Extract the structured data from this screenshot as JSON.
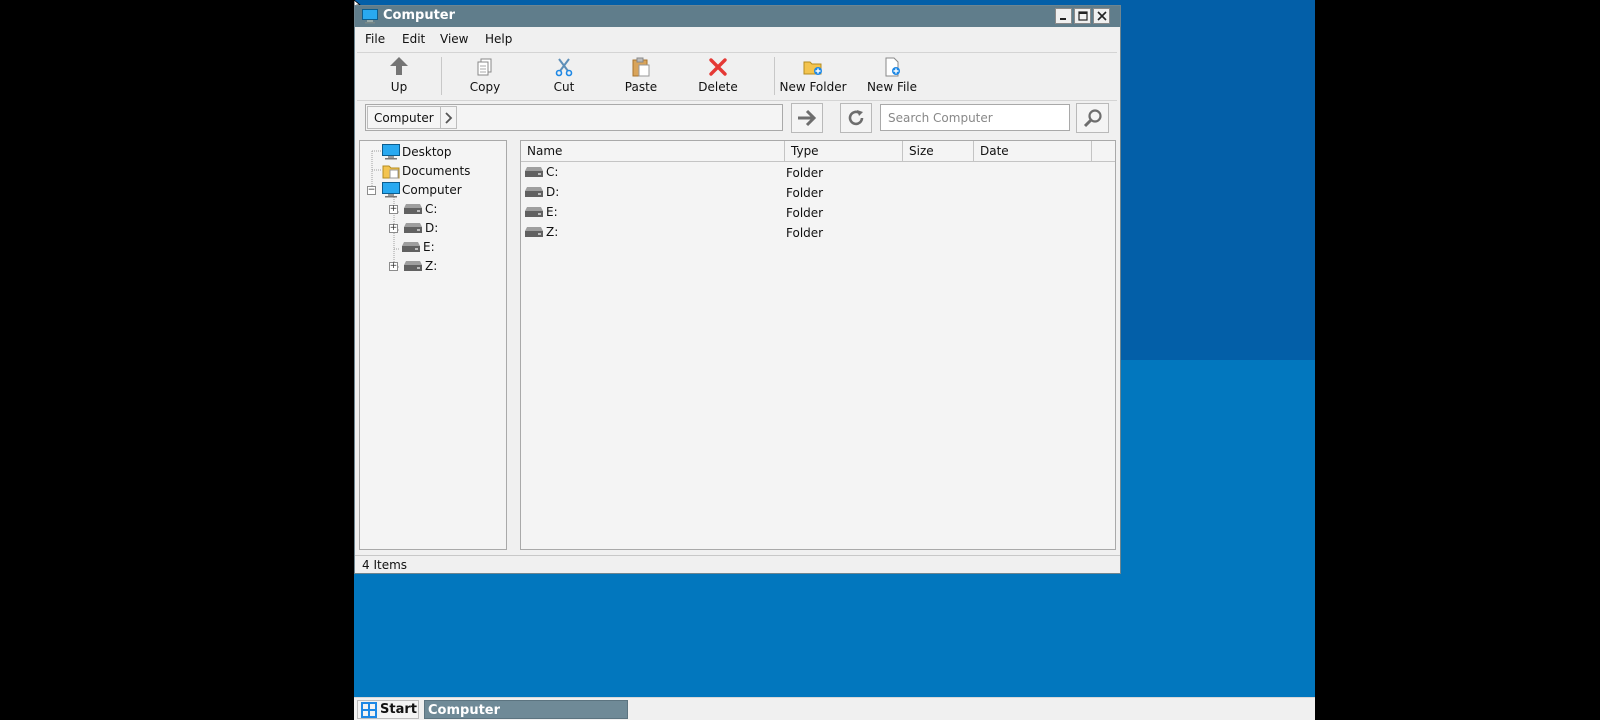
{
  "window": {
    "title": "Computer",
    "controls": [
      "minimize",
      "maximize",
      "close"
    ]
  },
  "menu": [
    "File",
    "Edit",
    "View",
    "Help"
  ],
  "toolbar": {
    "up": "Up",
    "copy": "Copy",
    "cut": "Cut",
    "paste": "Paste",
    "delete": "Delete",
    "new_folder": "New Folder",
    "new_file": "New File"
  },
  "address": {
    "crumb": "Computer",
    "search_placeholder": "Search Computer"
  },
  "tree": [
    {
      "label": "Desktop",
      "icon": "desktop-icon"
    },
    {
      "label": "Documents",
      "icon": "documents-folder-icon"
    },
    {
      "label": "Computer",
      "icon": "computer-icon",
      "expanded": true
    },
    {
      "label": "C:",
      "icon": "drive-icon",
      "expandable": true
    },
    {
      "label": "D:",
      "icon": "drive-icon",
      "expandable": true
    },
    {
      "label": "E:",
      "icon": "drive-icon",
      "expandable": false
    },
    {
      "label": "Z:",
      "icon": "drive-icon",
      "expandable": true
    }
  ],
  "list": {
    "columns": [
      "Name",
      "Type",
      "Size",
      "Date"
    ],
    "rows": [
      {
        "name": "C:",
        "type": "Folder"
      },
      {
        "name": "D:",
        "type": "Folder"
      },
      {
        "name": "E:",
        "type": "Folder"
      },
      {
        "name": "Z:",
        "type": "Folder"
      }
    ]
  },
  "status": "4 Items",
  "taskbar": {
    "start": "Start",
    "task": "Computer"
  },
  "colors": {
    "titlebar": "#607d8b",
    "desktop": "#0277be",
    "desktop_upper": "#035fa8",
    "delete_red": "#e53935",
    "accent_blue": "#1e88e5"
  }
}
